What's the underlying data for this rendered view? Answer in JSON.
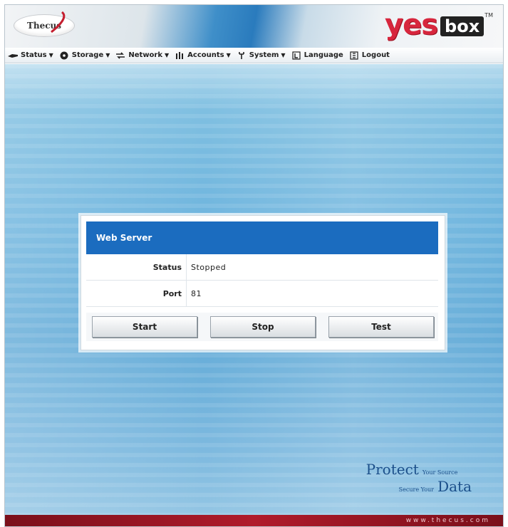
{
  "header": {
    "logo_text": "Thecus",
    "brand_yes": "yes",
    "brand_box": "box",
    "brand_tm": "TM"
  },
  "menu": [
    {
      "label": "Status",
      "icon": "status-icon"
    },
    {
      "label": "Storage",
      "icon": "storage-icon"
    },
    {
      "label": "Network",
      "icon": "network-icon"
    },
    {
      "label": "Accounts",
      "icon": "accounts-icon"
    },
    {
      "label": "System",
      "icon": "system-icon"
    },
    {
      "label": "Language",
      "icon": "language-icon"
    },
    {
      "label": "Logout",
      "icon": "logout-icon"
    }
  ],
  "dialog": {
    "title": "Web Server",
    "status_label": "Status",
    "status_value": "Stopped",
    "port_label": "Port",
    "port_value": "81",
    "buttons": {
      "start": "Start",
      "stop": "Stop",
      "test": "Test"
    }
  },
  "footer": {
    "protect": "Protect",
    "your_source": "Your Source",
    "secure_your": "Secure Your",
    "data": "Data",
    "url": "www.thecus.com"
  },
  "colors": {
    "title_bar": "#1b6cbf",
    "brand_red": "#d7263d",
    "footer_red": "#b01b2b"
  }
}
